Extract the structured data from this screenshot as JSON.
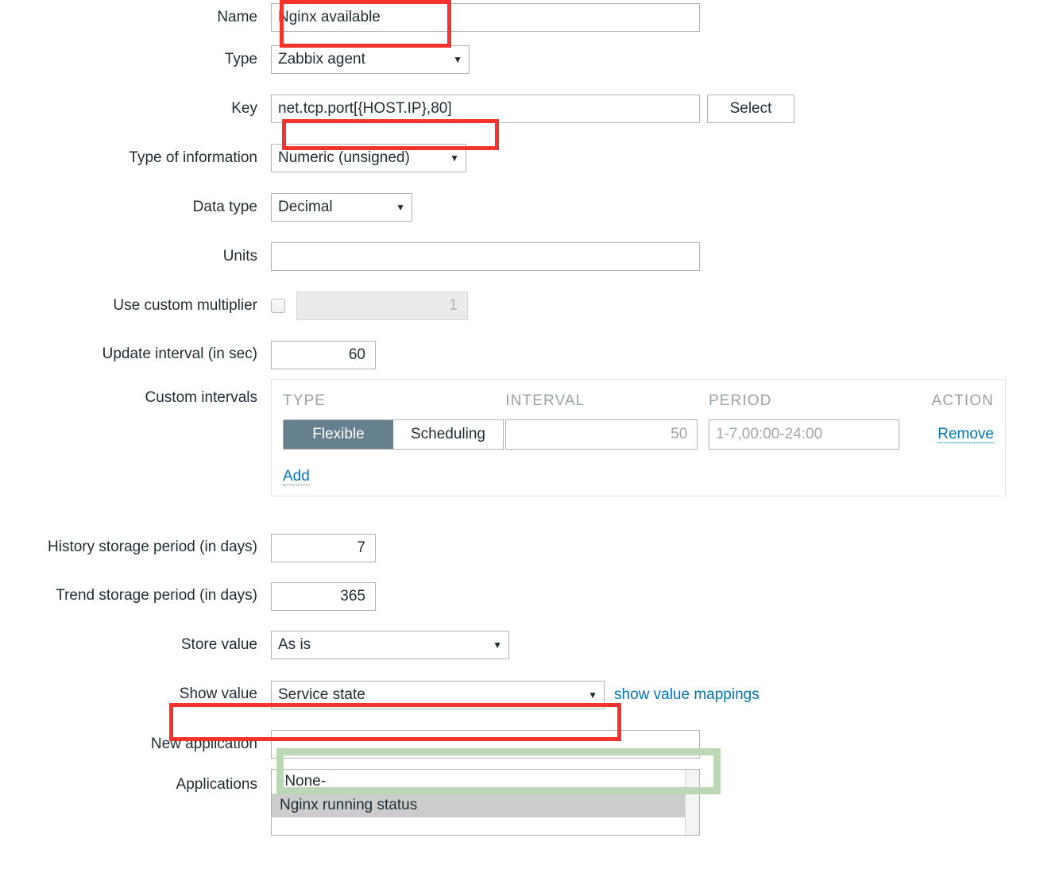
{
  "form": {
    "rows": {
      "name": {
        "label": "Name",
        "value": "Nginx available"
      },
      "type": {
        "label": "Type",
        "value": "Zabbix agent"
      },
      "key": {
        "label": "Key",
        "value": "net.tcp.port[{HOST.IP},80]",
        "select_button": "Select"
      },
      "type_of_information": {
        "label": "Type of information",
        "value": "Numeric (unsigned)"
      },
      "data_type": {
        "label": "Data type",
        "value": "Decimal"
      },
      "units": {
        "label": "Units",
        "value": ""
      },
      "use_custom_multiplier": {
        "label": "Use custom multiplier",
        "checked": false,
        "multiplier_placeholder": "1"
      },
      "update_interval": {
        "label": "Update interval (in sec)",
        "value": "60"
      },
      "custom_intervals": {
        "label": "Custom intervals",
        "headers": [
          "TYPE",
          "INTERVAL",
          "PERIOD",
          "ACTION"
        ],
        "entries": [
          {
            "type_options": [
              "Flexible",
              "Scheduling"
            ],
            "type_selected": "Flexible",
            "interval_placeholder": "50",
            "period_placeholder": "1-7,00:00-24:00",
            "action_label": "Remove"
          }
        ],
        "add_label": "Add"
      },
      "history_storage_period": {
        "label": "History storage period (in days)",
        "value": "7"
      },
      "trend_storage_period": {
        "label": "Trend storage period (in days)",
        "value": "365"
      },
      "store_value": {
        "label": "Store value",
        "value": "As is"
      },
      "show_value": {
        "label": "Show value",
        "value": "Service state",
        "mappings_link": "show value mappings"
      },
      "new_application": {
        "label": "New application",
        "value": ""
      },
      "applications": {
        "label": "Applications",
        "options": [
          {
            "label": "-None-",
            "selected": false
          },
          {
            "label": "Nginx running status",
            "selected": true
          }
        ]
      }
    }
  },
  "annotations": {
    "name_highlight": {
      "color": "#f4322e"
    },
    "key_highlight": {
      "color": "#f4322e"
    },
    "show_value_highlight": {
      "color": "#f4322e"
    },
    "new_application_highlight": {
      "color": "#bcd7b4"
    }
  },
  "icons": {
    "caret": "▼"
  }
}
